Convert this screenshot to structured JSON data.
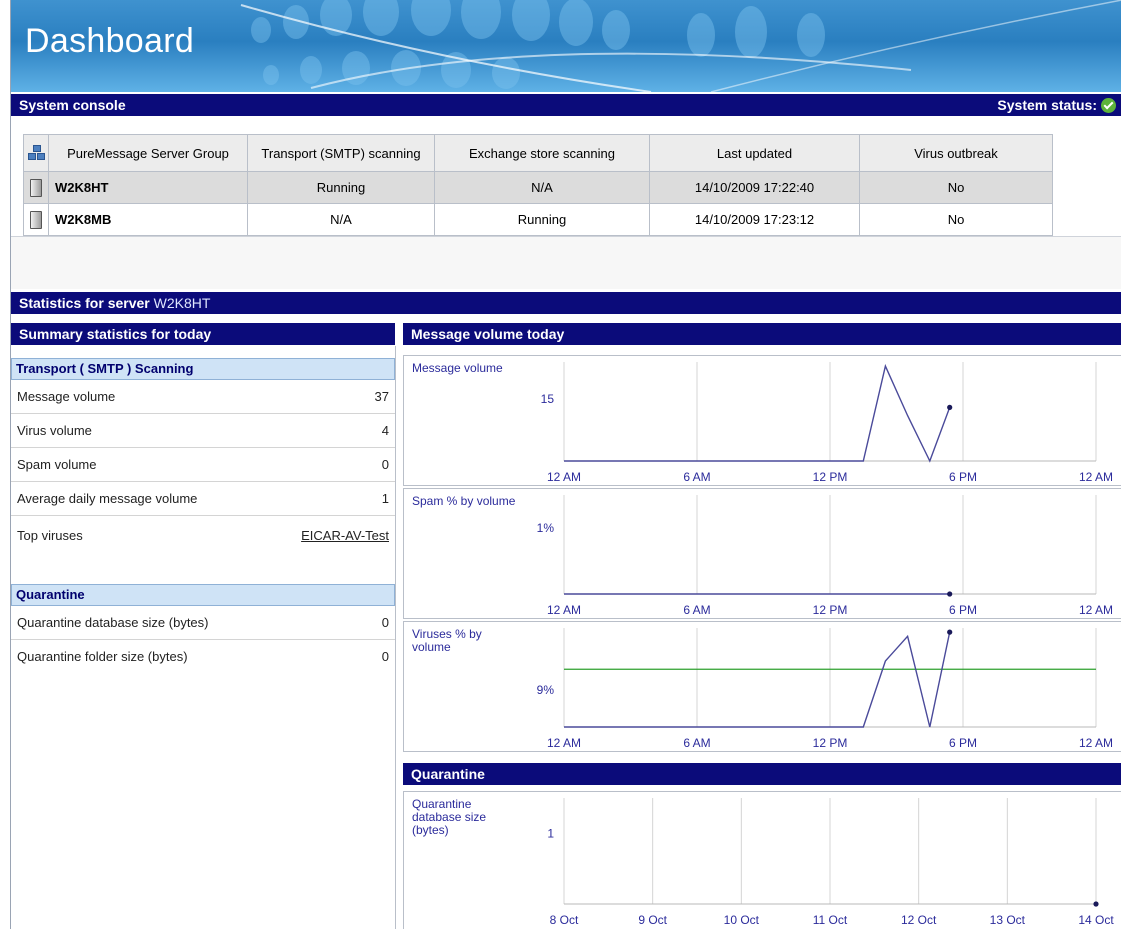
{
  "header": {
    "title": "Dashboard"
  },
  "system_console": {
    "title": "System console",
    "status_label": "System status:",
    "status_icon": "check-ok-icon",
    "columns": [
      "PureMessage Server Group",
      "Transport (SMTP) scanning",
      "Exchange store scanning",
      "Last updated",
      "Virus outbreak"
    ],
    "rows": [
      {
        "name": "W2K8HT",
        "transport": "Running",
        "exchange": "N/A",
        "updated": "14/10/2009 17:22:40",
        "outbreak": "No"
      },
      {
        "name": "W2K8MB",
        "transport": "N/A",
        "exchange": "Running",
        "updated": "14/10/2009 17:23:12",
        "outbreak": "No"
      }
    ]
  },
  "statistics": {
    "title": "Statistics for server",
    "server": "W2K8HT"
  },
  "summary": {
    "title": "Summary statistics for today",
    "transport_header": "Transport ( SMTP ) Scanning",
    "transport_rows": [
      {
        "label": "Message volume",
        "value": "37"
      },
      {
        "label": "Virus volume",
        "value": "4"
      },
      {
        "label": "Spam volume",
        "value": "0"
      },
      {
        "label": "Average daily message volume",
        "value": "1"
      },
      {
        "label": "Top viruses",
        "value": "EICAR-AV-Test"
      }
    ],
    "quarantine_header": "Quarantine",
    "quarantine_rows": [
      {
        "label": "Quarantine database size (bytes)",
        "value": "0"
      },
      {
        "label": "Quarantine folder size (bytes)",
        "value": "0"
      }
    ]
  },
  "message_volume_title": "Message volume today",
  "quarantine_title": "Quarantine",
  "colors": {
    "navy": "#0b0b7a",
    "series": "#4a4a9a",
    "threshold": "#2ea02e",
    "grid": "#d4d4d4"
  },
  "chart_data": [
    {
      "type": "line",
      "title": "Message volume",
      "ylabel": "",
      "x_ticks": [
        "12 AM",
        "6 AM",
        "12 PM",
        "6 PM",
        "12 AM"
      ],
      "y_ticks": [
        {
          "label": "15",
          "value": 15
        }
      ],
      "x_hours": [
        0,
        13.5,
        14.5,
        15.5,
        16.5,
        17.4
      ],
      "values": [
        0,
        0,
        23,
        11,
        0,
        13
      ],
      "ylim": [
        0,
        24
      ]
    },
    {
      "type": "line",
      "title": "Spam % by volume",
      "x_ticks": [
        "12 AM",
        "6 AM",
        "12 PM",
        "6 PM",
        "12 AM"
      ],
      "y_ticks": [
        {
          "label": "1%",
          "value": 1
        }
      ],
      "x_hours": [
        0,
        17.4
      ],
      "values": [
        0,
        0
      ],
      "ylim": [
        0,
        1.5
      ]
    },
    {
      "type": "line",
      "title": "Viruses % by volume",
      "x_ticks": [
        "12 AM",
        "6 AM",
        "12 PM",
        "6 PM",
        "12 AM"
      ],
      "y_ticks": [
        {
          "label": "9%",
          "value": 9
        }
      ],
      "x_hours": [
        0,
        13.5,
        14.5,
        15.5,
        16.5,
        17.4
      ],
      "values": [
        0,
        0,
        16,
        22,
        0,
        23
      ],
      "threshold": 14,
      "ylim": [
        0,
        24
      ]
    },
    {
      "type": "line",
      "title": "Quarantine database size (bytes)",
      "x_ticks": [
        "8 Oct",
        "9 Oct",
        "10 Oct",
        "11 Oct",
        "12 Oct",
        "13 Oct",
        "14 Oct"
      ],
      "y_ticks": [
        {
          "label": "1",
          "value": 1
        }
      ],
      "x_days": [
        6
      ],
      "values": [
        0
      ],
      "ylim": [
        0,
        1.5
      ]
    }
  ]
}
